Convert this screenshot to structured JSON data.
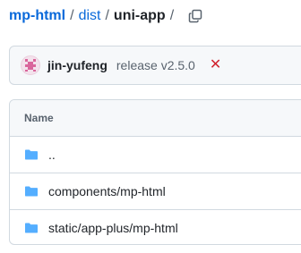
{
  "breadcrumb": {
    "root": "mp-html",
    "separator": "/",
    "dist": "dist",
    "current": "uni-app",
    "trailing_separator": "/"
  },
  "commit": {
    "author": "jin-yufeng",
    "message": "release v2.5.0",
    "status_symbol": "✕",
    "status_color": "#d1242f"
  },
  "table": {
    "header_name": "Name",
    "rows": [
      {
        "label": "..",
        "icon": "folder-icon"
      },
      {
        "label": "components/mp-html",
        "icon": "folder-icon"
      },
      {
        "label": "static/app-plus/mp-html",
        "icon": "folder-icon"
      }
    ]
  },
  "colors": {
    "link": "#0969da",
    "folder": "#54aeff",
    "border": "#d1d9e0",
    "muted": "#59636e"
  }
}
